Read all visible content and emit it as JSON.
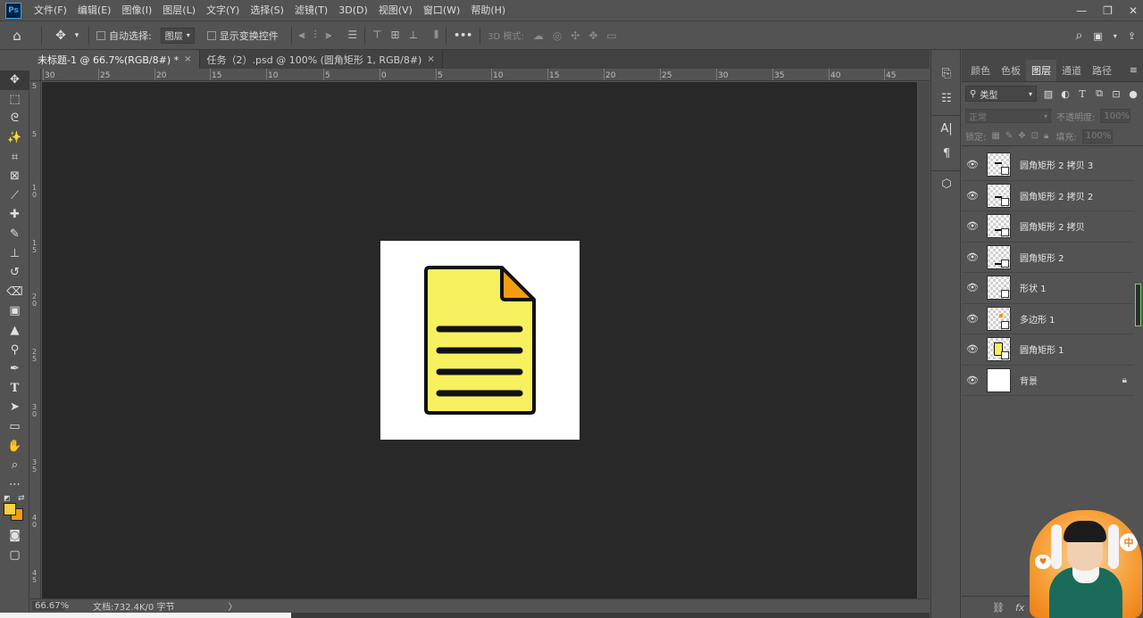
{
  "app": {
    "logo": "Ps"
  },
  "menu": [
    "文件(F)",
    "编辑(E)",
    "图像(I)",
    "图层(L)",
    "文字(Y)",
    "选择(S)",
    "滤镜(T)",
    "3D(D)",
    "视图(V)",
    "窗口(W)",
    "帮助(H)"
  ],
  "options": {
    "auto_select_label": "自动选择:",
    "auto_select_value": "图层",
    "show_transform_label": "显示变换控件",
    "more": "•••",
    "mode3d_label": "3D 模式:"
  },
  "tabs": [
    {
      "label": "未标题-1 @ 66.7%(RGB/8#) *",
      "close": "×"
    },
    {
      "label": "任务（2）.psd @ 100% (圆角矩形 1, RGB/8#)",
      "close": "×"
    }
  ],
  "ruler_h": [
    "30",
    "25",
    "20",
    "15",
    "10",
    "5",
    "0",
    "5",
    "10",
    "15",
    "20",
    "25",
    "30",
    "35",
    "40",
    "45"
  ],
  "ruler_v": [
    "5",
    "0",
    "5",
    "1\n0",
    "1\n5",
    "2\n0",
    "2\n5",
    "3\n0",
    "3\n5",
    "4\n0",
    "4\n5",
    "5\n0",
    "5\n5"
  ],
  "status": {
    "zoom": "66.67%",
    "doc": "文档:732.4K/0 字节",
    "arrow": "〉"
  },
  "panel": {
    "tabs": [
      "颜色",
      "色板",
      "图层",
      "通道",
      "路径"
    ],
    "active_tab": "图层",
    "filter_label": "类型",
    "blend_mode": "正常",
    "opacity_label": "不透明度:",
    "opacity_value": "100%",
    "lock_label": "锁定:",
    "fill_label": "填充:",
    "fill_value": "100%"
  },
  "layers": [
    {
      "name": "圆角矩形 2 拷贝 3",
      "thumb": "bar"
    },
    {
      "name": "圆角矩形 2 拷贝 2",
      "thumb": "bar"
    },
    {
      "name": "圆角矩形 2 拷贝",
      "thumb": "bar"
    },
    {
      "name": "圆角矩形 2",
      "thumb": "bar"
    },
    {
      "name": "形状 1",
      "thumb": "empty"
    },
    {
      "name": "多边形 1",
      "thumb": "dot"
    },
    {
      "name": "圆角矩形 1",
      "thumb": "doc"
    },
    {
      "name": "背景",
      "thumb": "white",
      "locked": true
    }
  ],
  "colors": {
    "foreground": "#f7d23a",
    "background": "#f39c12",
    "doc_fill": "#f7f05f",
    "doc_corner": "#f39c12"
  },
  "avatar": {
    "bubble": "中",
    "heart": "♥"
  }
}
